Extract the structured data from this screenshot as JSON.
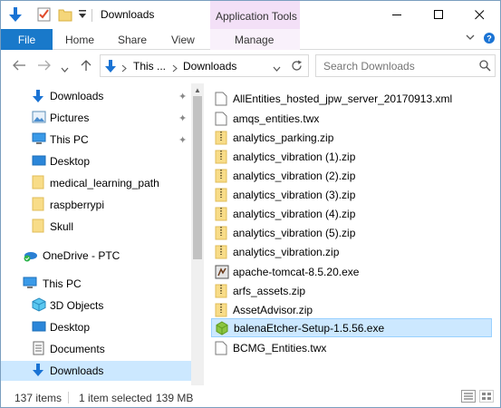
{
  "window": {
    "title": "Downloads",
    "contextual_tab_group": "Application Tools",
    "accent": "#1979ca"
  },
  "titlebar_icons": [
    "down-arrow-icon",
    "properties-check-icon",
    "new-folder-icon",
    "customize-dropdown-icon"
  ],
  "caption_buttons": [
    "minimize",
    "maximize",
    "close"
  ],
  "ribbon": {
    "tabs": [
      "File",
      "Home",
      "Share",
      "View",
      "Manage"
    ]
  },
  "address": {
    "segments": [
      "This ...",
      "Downloads"
    ],
    "search_placeholder": "Search Downloads"
  },
  "nav": {
    "items": [
      {
        "label": "Downloads",
        "icon": "download-arrow-icon",
        "pinned": true
      },
      {
        "label": "Pictures",
        "icon": "pictures-icon",
        "pinned": true
      },
      {
        "label": "This PC",
        "icon": "computer-icon",
        "pinned": true
      },
      {
        "label": "Desktop",
        "icon": "desktop-icon",
        "pinned": false
      },
      {
        "label": "medical_learning_path",
        "icon": "folder-icon",
        "pinned": false
      },
      {
        "label": "raspberrypi",
        "icon": "folder-icon",
        "pinned": false
      },
      {
        "label": "Skull",
        "icon": "folder-icon",
        "pinned": false
      },
      {
        "label": "OneDrive - PTC",
        "icon": "onedrive-icon",
        "pinned": false
      },
      {
        "label": "This PC",
        "icon": "computer-icon",
        "pinned": false
      },
      {
        "label": "3D Objects",
        "icon": "3d-objects-icon",
        "pinned": false
      },
      {
        "label": "Desktop",
        "icon": "desktop-icon",
        "pinned": false
      },
      {
        "label": "Documents",
        "icon": "documents-icon",
        "pinned": false
      },
      {
        "label": "Downloads",
        "icon": "download-arrow-icon",
        "pinned": false,
        "selected": true
      }
    ]
  },
  "files": [
    {
      "name": "AllEntities_hosted_jpw_server_20170913.xml",
      "type": "xml"
    },
    {
      "name": "amqs_entities.twx",
      "type": "doc"
    },
    {
      "name": "analytics_parking.zip",
      "type": "zip"
    },
    {
      "name": "analytics_vibration (1).zip",
      "type": "zip"
    },
    {
      "name": "analytics_vibration (2).zip",
      "type": "zip"
    },
    {
      "name": "analytics_vibration (3).zip",
      "type": "zip"
    },
    {
      "name": "analytics_vibration (4).zip",
      "type": "zip"
    },
    {
      "name": "analytics_vibration (5).zip",
      "type": "zip"
    },
    {
      "name": "analytics_vibration.zip",
      "type": "zip"
    },
    {
      "name": "apache-tomcat-8.5.20.exe",
      "type": "exe"
    },
    {
      "name": "arfs_assets.zip",
      "type": "zip"
    },
    {
      "name": "AssetAdvisor.zip",
      "type": "zip"
    },
    {
      "name": "balenaEtcher-Setup-1.5.56.exe",
      "type": "etcher",
      "selected": true
    },
    {
      "name": "BCMG_Entities.twx",
      "type": "doc"
    }
  ],
  "status": {
    "item_count": "137 items",
    "selection": "1 item selected",
    "size": "139 MB"
  }
}
